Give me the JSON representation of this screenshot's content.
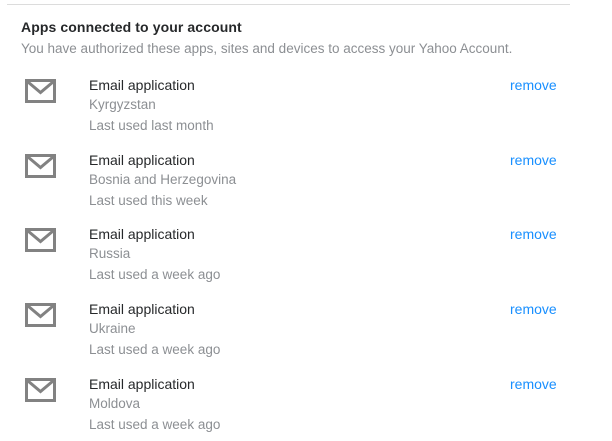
{
  "section": {
    "title": "Apps connected to your account",
    "subtitle": "You have authorized these apps, sites and devices to access your Yahoo Account."
  },
  "colors": {
    "title": "#26282a",
    "secondary_text": "#8c8f93",
    "link": "#188fff",
    "icon": "#828282"
  },
  "apps": [
    {
      "icon": "envelope-icon",
      "name": "Email application",
      "location": "Kyrgyzstan",
      "last_used": "Last used last month",
      "action": "remove"
    },
    {
      "icon": "envelope-icon",
      "name": "Email application",
      "location": "Bosnia and Herzegovina",
      "last_used": "Last used this week",
      "action": "remove"
    },
    {
      "icon": "envelope-icon",
      "name": "Email application",
      "location": "Russia",
      "last_used": "Last used a week ago",
      "action": "remove"
    },
    {
      "icon": "envelope-icon",
      "name": "Email application",
      "location": "Ukraine",
      "last_used": "Last used a week ago",
      "action": "remove"
    },
    {
      "icon": "envelope-icon",
      "name": "Email application",
      "location": "Moldova",
      "last_used": "Last used a week ago",
      "action": "remove"
    }
  ]
}
